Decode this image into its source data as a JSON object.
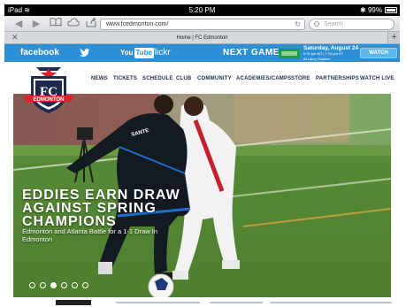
{
  "status_bar": {
    "device": "iPad",
    "time": "5:20 PM",
    "battery": "99%"
  },
  "browser": {
    "url": "www.fcedmonton.com/",
    "search_placeholder": "Search",
    "tab_title": "Home | FC Edmonton",
    "new_tab": "+"
  },
  "social_bar": {
    "facebook": "facebook",
    "youtube_a": "You",
    "youtube_b": "Tube",
    "flickr": "flickr",
    "next_game_label": "NEXT GAME :",
    "game_date": "Saturday, August 24",
    "game_time": "5:30 pm MT | 7:30 pm ET",
    "game_venue": "At Laing Stadium",
    "watch_label": "WATCH",
    "colors": {
      "bar": "#2d8fd5"
    }
  },
  "logo": {
    "top_text": "FC",
    "bottom_text": "EDMONTON",
    "colors": {
      "red": "#d9252a",
      "navy": "#1c2b4d"
    }
  },
  "nav": {
    "items": [
      "NEWS",
      "TICKETS",
      "SCHEDULE",
      "CLUB",
      "COMMUNITY",
      "ACADEMIES/CAMPS",
      "STORE",
      "PARTNERSHIPS",
      "WATCH LIVE"
    ]
  },
  "hero": {
    "headline_1": "EDDIES EARN DRAW",
    "headline_2": "AGAINST SPRING",
    "headline_3": "CHAMPIONS",
    "subtitle": "Edmonton and Atlanta Battle for a 1-1 Draw In Edmonton",
    "jersey_word": "SANTE",
    "slide_count": 6,
    "active_slide": 3
  }
}
